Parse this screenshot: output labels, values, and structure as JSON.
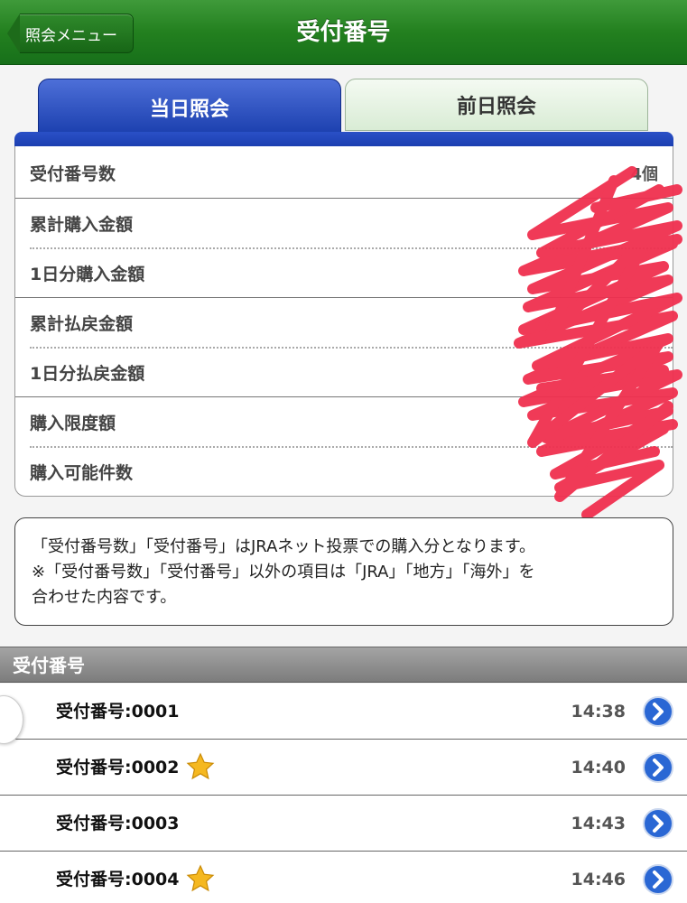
{
  "header": {
    "back_label": "照会メニュー",
    "title": "受付番号"
  },
  "tabs": [
    {
      "label": "当日照会",
      "active": true
    },
    {
      "label": "前日照会",
      "active": false
    }
  ],
  "summary": {
    "rows": [
      {
        "label": "受付番号数",
        "value": "4個"
      },
      {
        "label": "累計購入金額",
        "value": ""
      },
      {
        "label": "1日分購入金額",
        "value": ""
      },
      {
        "label": "累計払戻金額",
        "value": ""
      },
      {
        "label": "1日分払戻金額",
        "value": ""
      },
      {
        "label": "購入限度額",
        "value": ""
      },
      {
        "label": "購入可能件数",
        "value": ""
      }
    ]
  },
  "note": {
    "line1": "「受付番号数」「受付番号」はJRAネット投票での購入分となります。",
    "line2": "※「受付番号数」「受付番号」以外の項目は「JRA」「地方」「海外」を",
    "line3": "合わせた内容です。"
  },
  "section": {
    "title": "受付番号"
  },
  "receipts": [
    {
      "label": "受付番号:0001",
      "time": "14:38",
      "starred": false
    },
    {
      "label": "受付番号:0002",
      "time": "14:40",
      "starred": true
    },
    {
      "label": "受付番号:0003",
      "time": "14:43",
      "starred": false
    },
    {
      "label": "受付番号:0004",
      "time": "14:46",
      "starred": true
    }
  ],
  "colors": {
    "header_green": "#23801f",
    "tab_blue": "#1b3fae",
    "scribble_red": "#f0304f",
    "chevron_blue": "#2a67d4",
    "star_gold": "#f5b820"
  },
  "icons": {
    "back": "back-arrow-icon",
    "star": "star-icon",
    "chevron": "chevron-right-icon"
  }
}
